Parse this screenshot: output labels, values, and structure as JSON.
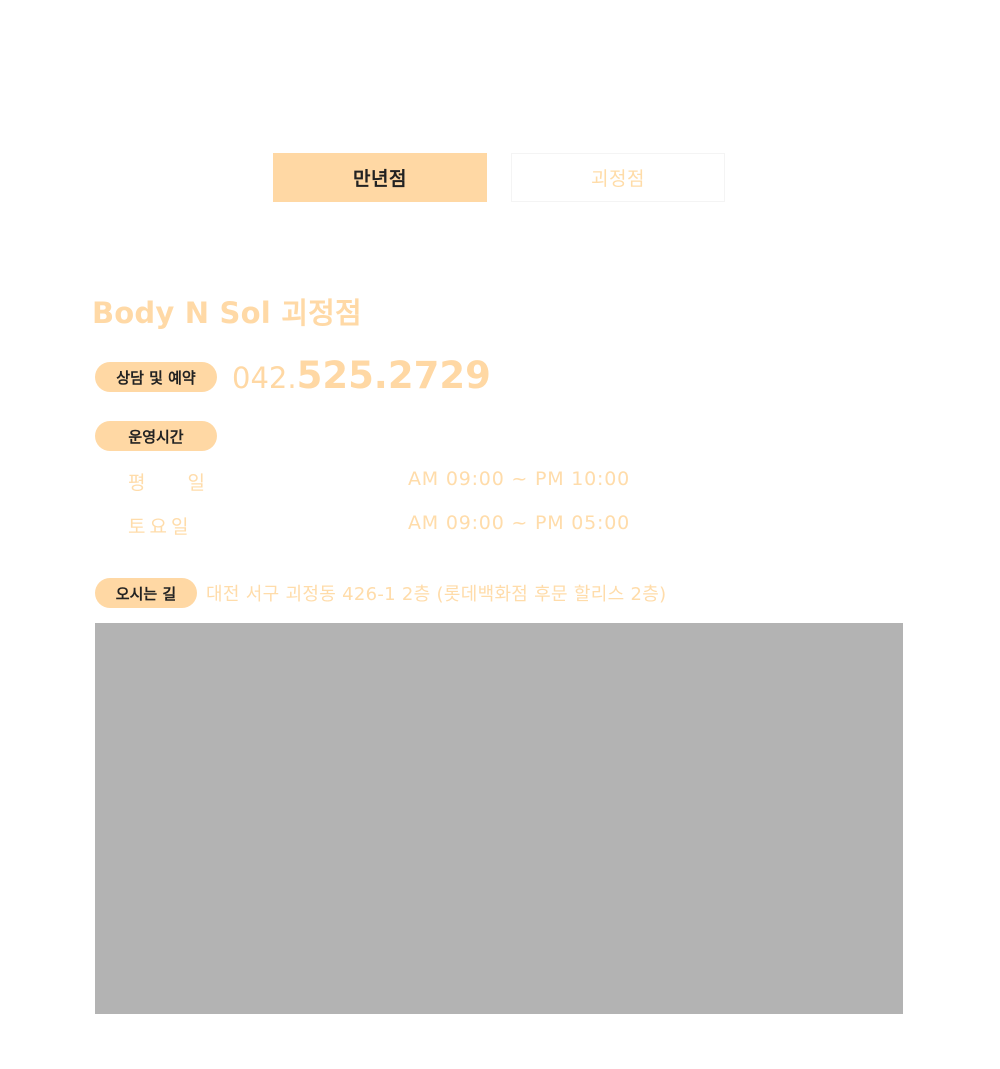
{
  "tabs": [
    {
      "label": "만년점",
      "active": true
    },
    {
      "label": "괴정점",
      "active": false
    }
  ],
  "branch": {
    "title": "Body N Sol 괴정점"
  },
  "contact": {
    "badge_label": "상담 및 예약",
    "phone_prefix": "042.",
    "phone_main": "525.2729"
  },
  "hours": {
    "badge_label": "운영시간",
    "rows": [
      {
        "day": "평 일",
        "time": "AM 09:00 ~ PM 10:00"
      },
      {
        "day": "토요일",
        "time": "AM 09:00 ~ PM 05:00"
      }
    ]
  },
  "directions": {
    "badge_label": "오시는 길",
    "address": "대전 서구 괴정동 426-1 2층 (롯데백화점 후문 할리스 2층)"
  },
  "colors": {
    "accent": "#ffd8a4",
    "accent_text": "#ffdcaa",
    "map_placeholder": "#b3b3b3",
    "dark_text": "#222222"
  }
}
